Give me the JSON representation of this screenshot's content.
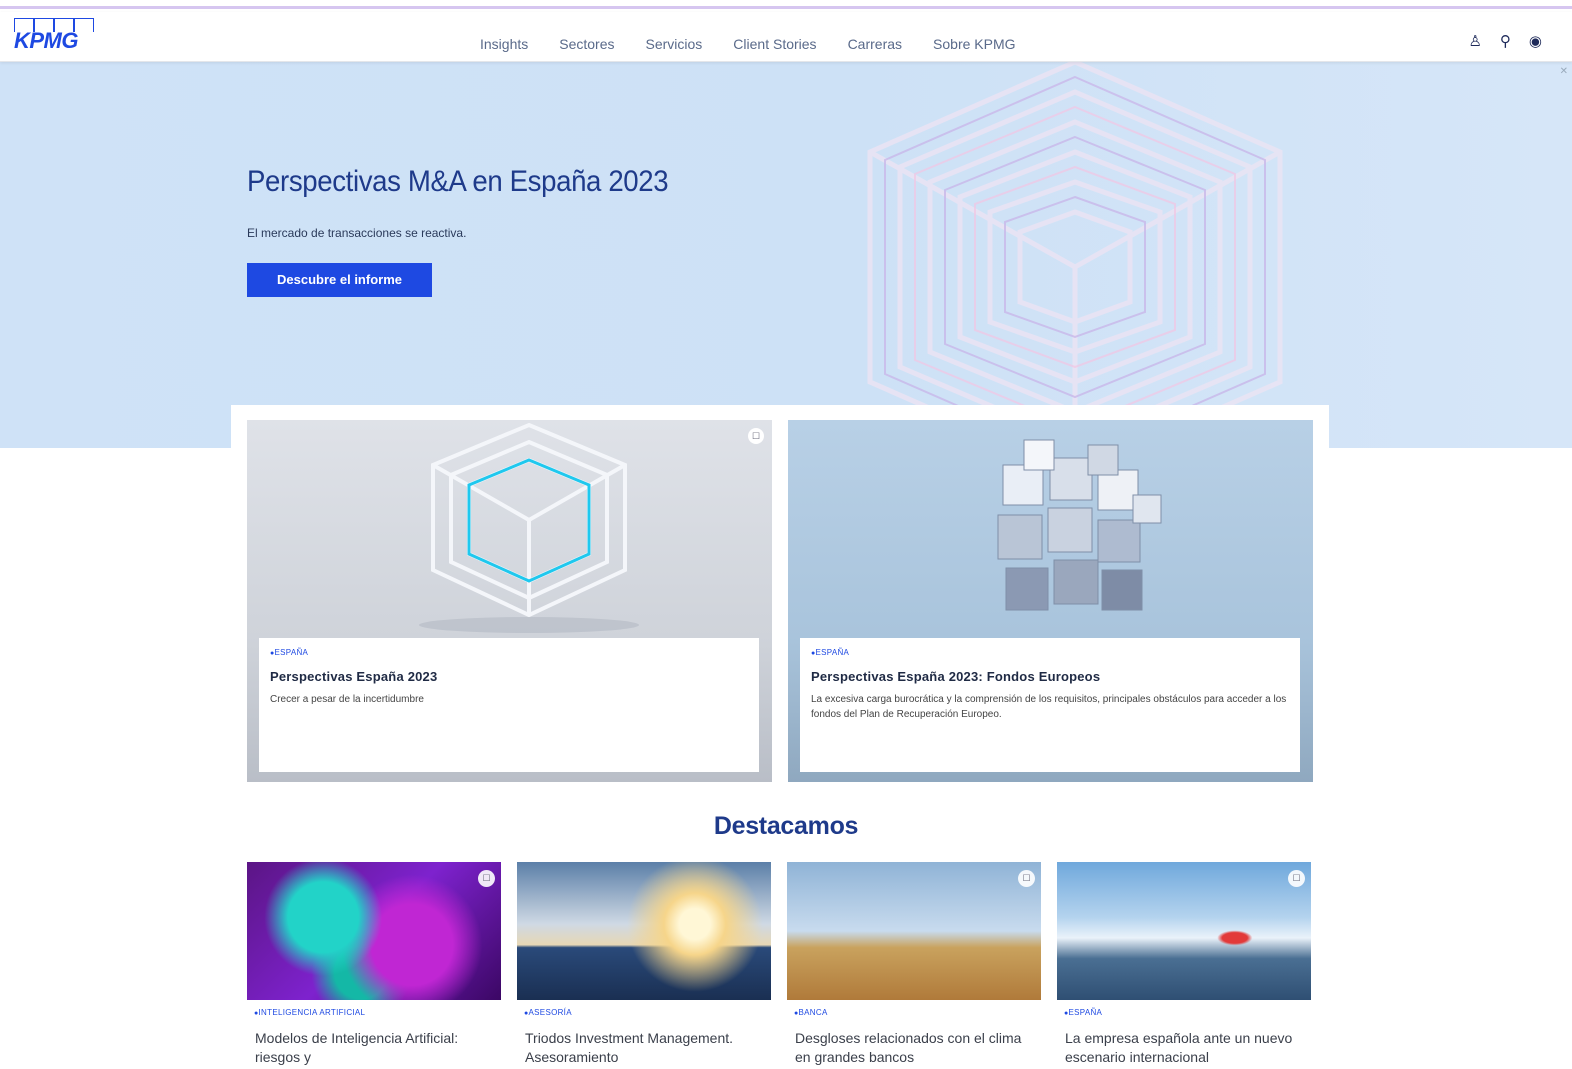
{
  "header": {
    "logo": "KPMG",
    "nav": [
      "Insights",
      "Sectores",
      "Servicios",
      "Client Stories",
      "Carreras",
      "Sobre KPMG"
    ],
    "icons": [
      "user-icon",
      "search-icon",
      "globe-icon"
    ]
  },
  "hero": {
    "title": "Perspectivas M&A en España 2023",
    "subtitle": "El mercado de transacciones se reactiva.",
    "button": "Descubre el informe"
  },
  "cards": [
    {
      "tag": "ESPAÑA",
      "title": "Perspectivas España 2023",
      "description": "Crecer a pesar de la incertidumbre"
    },
    {
      "tag": "ESPAÑA",
      "title": "Perspectivas España 2023: Fondos Europeos",
      "description": "La excesiva carga burocrática y la comprensión de los requisitos, principales obstáculos para acceder a los fondos del Plan de Recuperación Europeo."
    }
  ],
  "featured": {
    "title": "Destacamos",
    "items": [
      {
        "tag": "INTELIGENCIA ARTIFICIAL",
        "title": "Modelos de Inteligencia Artificial: riesgos y"
      },
      {
        "tag": "ASESORÍA",
        "title": "Triodos Investment Management. Asesoramiento"
      },
      {
        "tag": "BANCA",
        "title": "Desgloses relacionados con el clima en grandes bancos"
      },
      {
        "tag": "ESPAÑA",
        "title": "La empresa española ante un nuevo escenario internacional"
      }
    ]
  },
  "colors": {
    "brand_blue": "#1e49e2",
    "heading_blue": "#1e3a8a",
    "hero_bg": "#cfe2f7"
  }
}
